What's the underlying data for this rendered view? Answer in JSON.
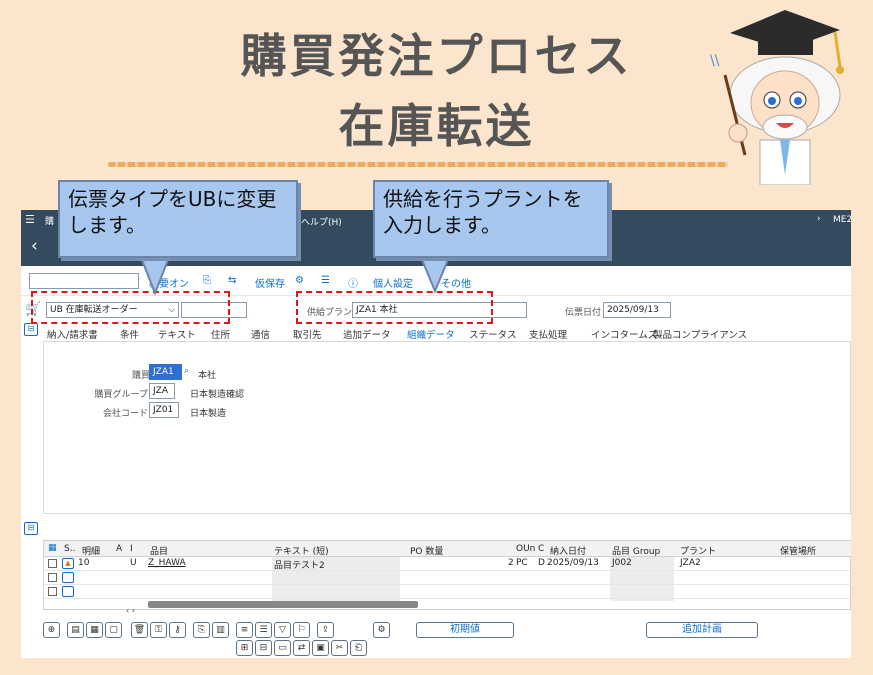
{
  "slide": {
    "title_line1": "購買発注プロセス",
    "title_line2": "在庫転送"
  },
  "callouts": {
    "left": "伝票タイプをUBに変更します。",
    "right": "供給を行うプラントを入力します。"
  },
  "shell": {
    "menu_icon": "☰",
    "app_short": "購",
    "help": "ヘルプ(H)",
    "right_text": "ME2",
    "chevron": "›"
  },
  "toolbar": {
    "back": "‹",
    "doc_overview": "概要オン",
    "hold": "仮保存",
    "personal": "個人設定",
    "more": "その他"
  },
  "header": {
    "doc_type": "UB 在庫転送オーダー",
    "vendor_value": "",
    "supply_plant_label": "供給プラント",
    "supply_plant_value": "JZA1 本社",
    "doc_date_label": "伝票日付",
    "doc_date_value": "2025/09/13"
  },
  "tabs": [
    "納入/請求書",
    "条件",
    "テキスト",
    "住所",
    "通信",
    "取引先",
    "追加データ",
    "組織データ",
    "ステータス",
    "支払処理",
    "インコタームズ",
    "製品コンプライアンス"
  ],
  "active_tab": "組織データ",
  "org": {
    "purch_org_label": "購買組織",
    "purch_org_value": "JZA1",
    "purch_org_desc": "本社",
    "purch_grp_label": "購買グループ",
    "purch_grp_value": "JZA",
    "purch_grp_desc": "日本製造確認",
    "company_label": "会社コード",
    "company_value": "JZ01",
    "company_desc": "日本製造"
  },
  "grid": {
    "headers": [
      "S..",
      "明細",
      "A",
      "I",
      "品目",
      "テキスト (短)",
      "PO 数量",
      "OUn",
      "C",
      "納入日付",
      "品目 Group",
      "プラント",
      "保管場所"
    ],
    "row": {
      "status": "▲",
      "item": "10",
      "acct": "",
      "itemcat": "U",
      "material": "Z_HAWA",
      "text": "品目テスト2",
      "qty": "2",
      "unit": "PC",
      "c": "D",
      "date": "2025/09/13",
      "group": "J002",
      "plant": "JZA2",
      "sloc": ""
    }
  },
  "buttons": {
    "defaults": "初期値",
    "planning": "追加計画"
  }
}
